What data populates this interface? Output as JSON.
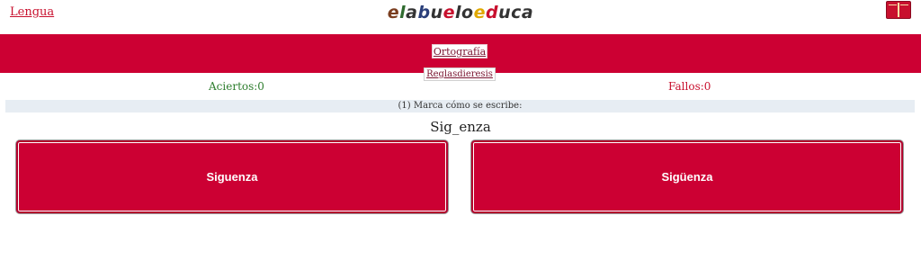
{
  "nav": {
    "back_link": "Lengua",
    "logo_letters": [
      {
        "ch": "e",
        "color": "#7a3d1f"
      },
      {
        "ch": "l",
        "color": "#2f6b2f"
      },
      {
        "ch": "a",
        "color": "#333333"
      },
      {
        "ch": "b",
        "color": "#2a3f7a"
      },
      {
        "ch": "u",
        "color": "#333333"
      },
      {
        "ch": "e",
        "color": "#c8102e"
      },
      {
        "ch": "l",
        "color": "#333333"
      },
      {
        "ch": "o",
        "color": "#333333"
      },
      {
        "ch": "e",
        "color": "#e0a800"
      },
      {
        "ch": "d",
        "color": "#c8102e"
      },
      {
        "ch": "u",
        "color": "#333333"
      },
      {
        "ch": "c",
        "color": "#333333"
      },
      {
        "ch": "a",
        "color": "#333333"
      }
    ],
    "book_icon": "book-icon"
  },
  "banner": {
    "tab_ortografia": "Ortografía",
    "tab_regla": "Reglasdieresis",
    "color": "#cc0033"
  },
  "score": {
    "aciertos": "Aciertos:0",
    "fallos": "Fallos:0"
  },
  "question": {
    "instruction": "(1) Marca cómo se escribe:",
    "word": "Sig_enza"
  },
  "options": [
    {
      "label": "Siguenza"
    },
    {
      "label": "Sigüenza"
    }
  ]
}
